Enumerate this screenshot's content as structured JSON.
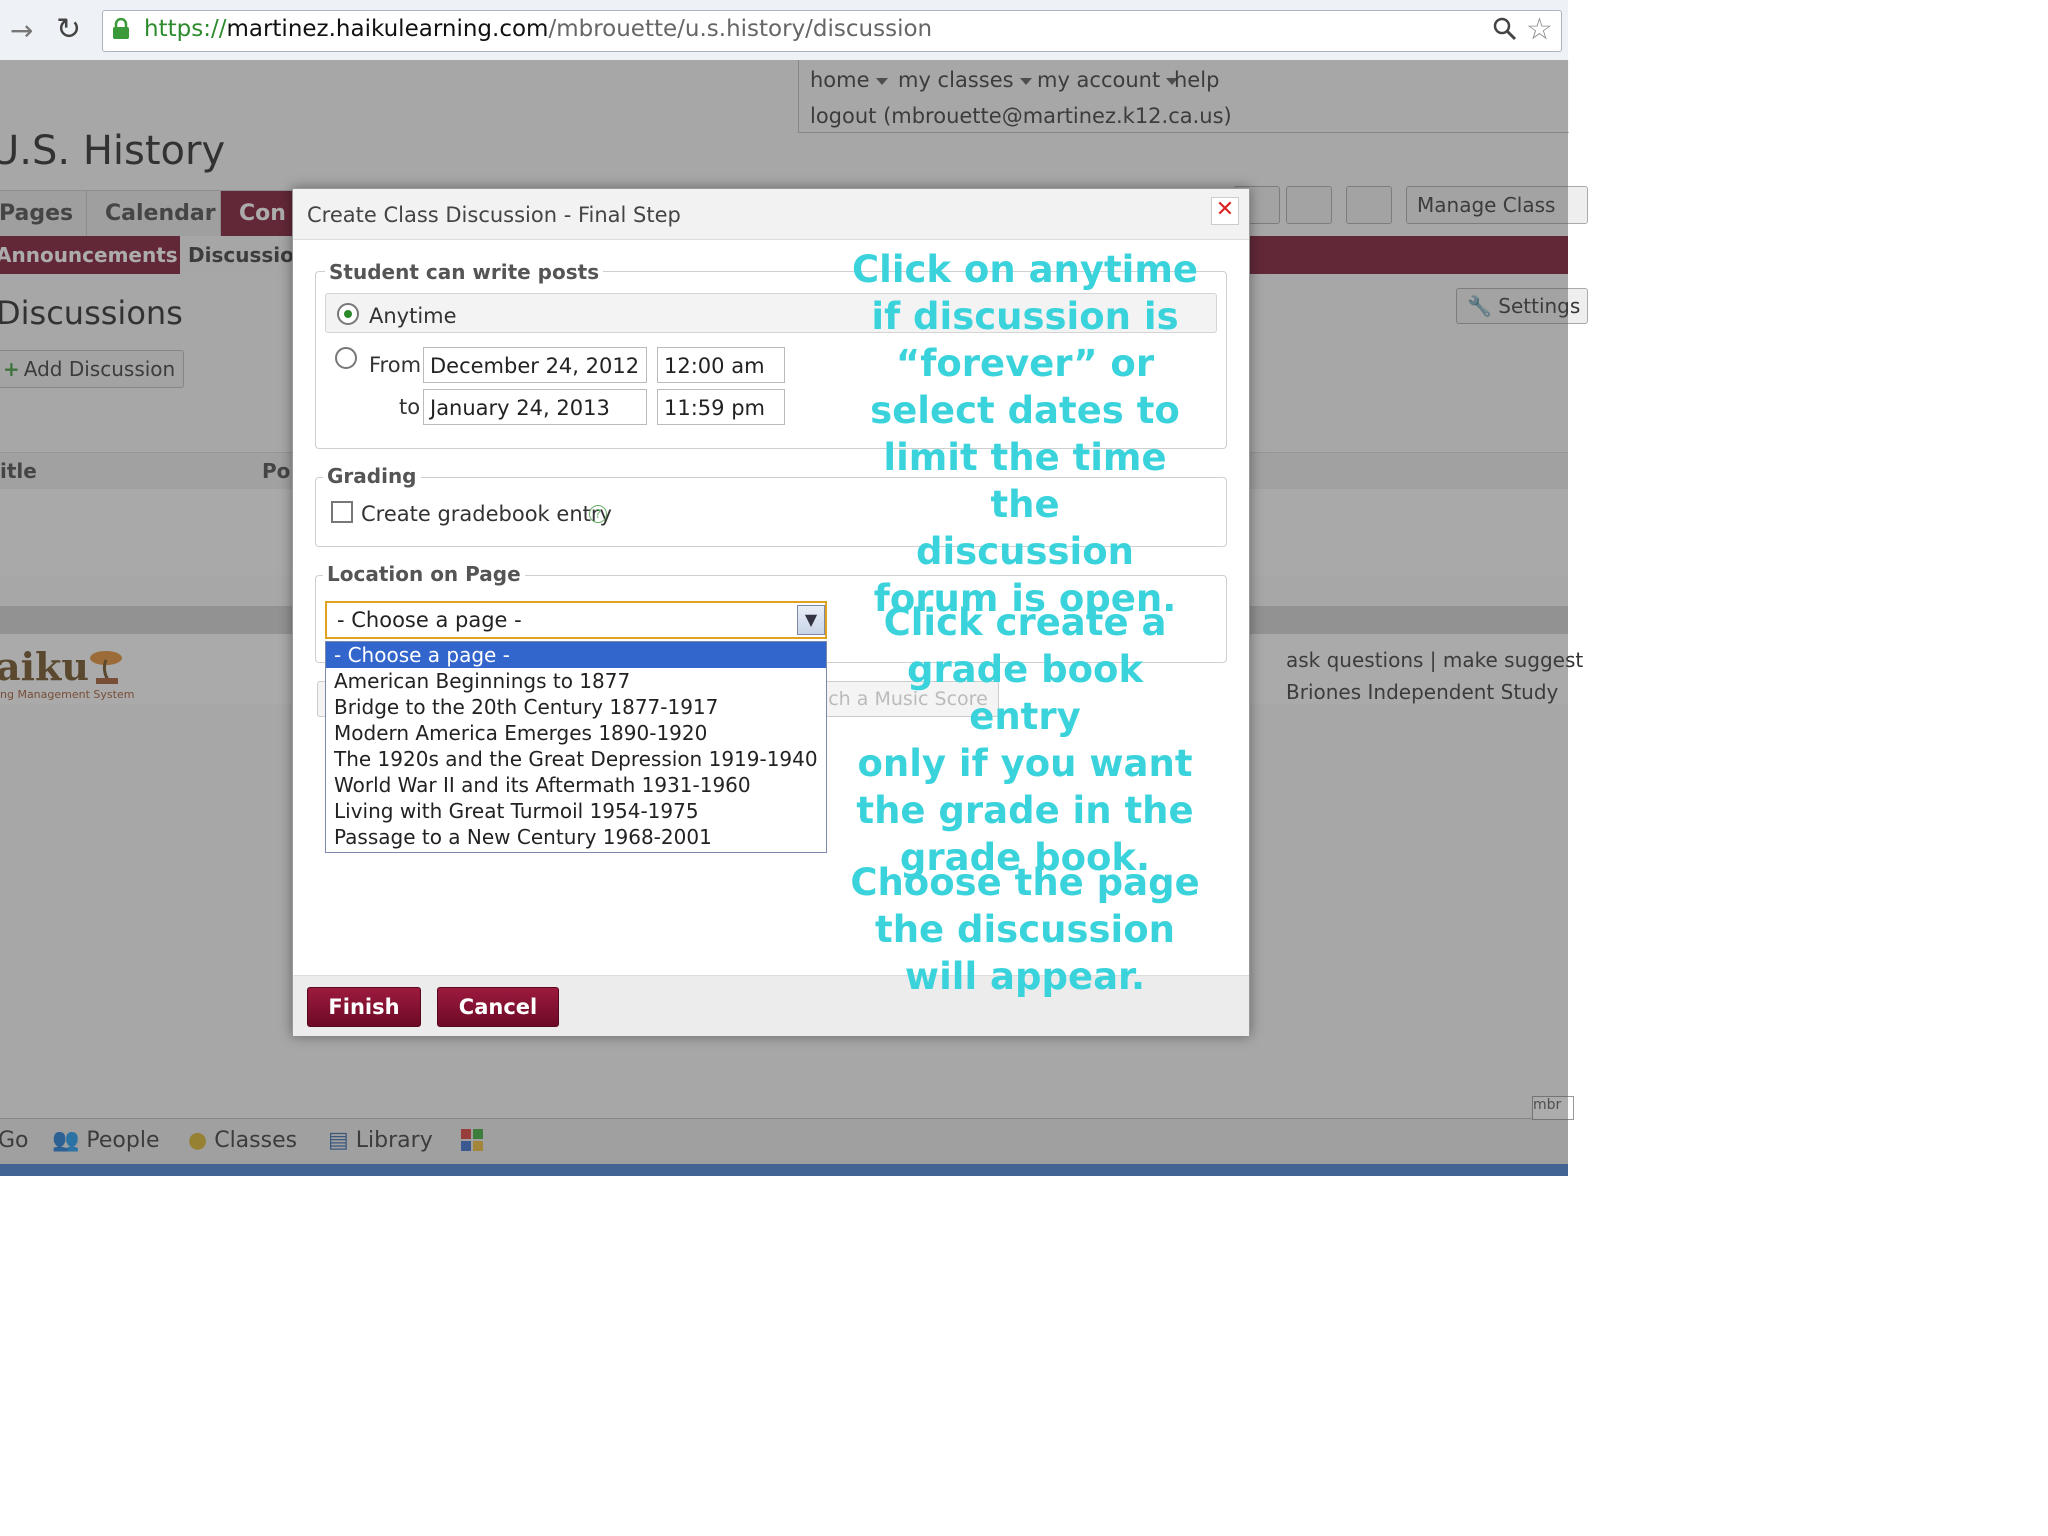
{
  "browser": {
    "url_proto": "https://",
    "url_host": "martinez.haikulearning.com",
    "url_path": "/mbrouette/u.s.history/discussion"
  },
  "topnav": {
    "home": "home",
    "my_classes": "my classes",
    "my_account": "my account",
    "help": "help",
    "logout": "logout (mbrouette@martinez.k12.ca.us)"
  },
  "class_title": "U.S. History",
  "tabs": {
    "pages": "Pages",
    "calendar": "Calendar",
    "content": "Con"
  },
  "subtabs": {
    "announcements": "Announcements",
    "discussions": "Discussion"
  },
  "heading": "Discussions",
  "add_discussion": "Add Discussion",
  "list_header": {
    "title": "itle",
    "posts": "Po"
  },
  "manage_class": "Manage Class",
  "settings": "Settings",
  "footer": {
    "logo": "aiku",
    "logo_sub": "ng Management System",
    "links": "ask questions | make suggest",
    "school": "Briones Independent Study"
  },
  "dock": {
    "go": "Go",
    "people": "People",
    "classes": "Classes",
    "library": "Library",
    "mbr": "mbr"
  },
  "modal": {
    "title": "Create Class Discussion - Final Step",
    "close": "✕",
    "posts_legend": "Student can write posts",
    "anytime": "Anytime",
    "from_label": "From",
    "to_label": "to",
    "from_date": "December 24, 2012",
    "from_time": "12:00 am",
    "to_date": "January 24, 2013",
    "to_time": "11:59 pm",
    "grading_legend": "Grading",
    "gradebook_label": "Create gradebook entry",
    "location_legend": "Location on Page",
    "select_value": "- Choose a page -",
    "options": [
      "- Choose a page -",
      "American Beginnings to 1877",
      "Bridge to the 20th Century 1877-1917",
      "Modern America Emerges 1890-1920",
      "The 1920s and the Great Depression 1919-1940",
      "World War II and its Aftermath 1931-1960",
      "Living with Great Turmoil 1954-1975",
      "Passage to a New Century 1968-2001"
    ],
    "music_btn": "ch a Music Score",
    "finish": "Finish",
    "cancel": "Cancel"
  },
  "annotations": {
    "note1": "Click on anytime\nif discussion is\n“forever” or\nselect dates to\nlimit the time the\ndiscussion\nforum is open.",
    "note2": "Click create a\ngrade book entry\nonly if you want\nthe grade in the\ngrade book.",
    "note3": "Choose the page\nthe discussion\nwill appear."
  },
  "colors": {
    "accent": "#7a0f2c",
    "annotation": "#3ad3dc",
    "selection": "#3366cc"
  }
}
